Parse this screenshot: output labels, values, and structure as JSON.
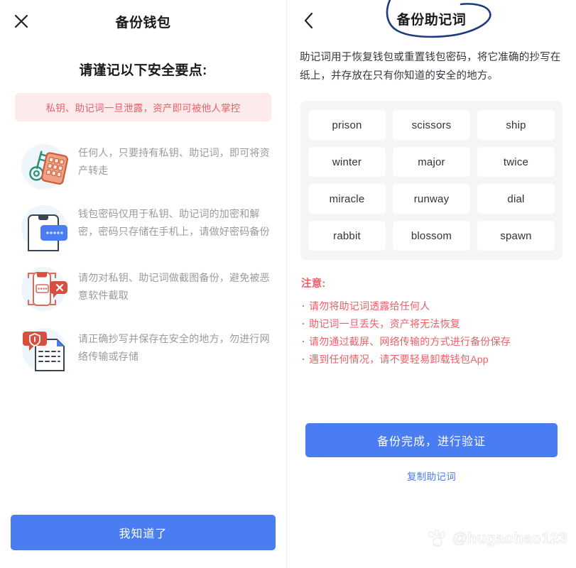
{
  "left_panel": {
    "close_icon": "close-icon",
    "title": "备份钱包",
    "section_heading": "请谨记以下安全要点:",
    "alert_banner": "私钥、助记词一旦泄露，资产即可被他人掌控",
    "tips": [
      {
        "icon": "key-and-keypad-icon",
        "text": "任何人，只要持有私钥、助记词，即可将资产转走"
      },
      {
        "icon": "phone-password-icon",
        "text": "钱包密码仅用于私钥、助记词的加密和解密，密码只存储在手机上，请做好密码备份"
      },
      {
        "icon": "no-screenshot-icon",
        "text": "请勿对私钥、助记词做截图备份，避免被恶意软件截取"
      },
      {
        "icon": "secure-document-icon",
        "text": "请正确抄写并保存在安全的地方，勿进行网络传输或存储"
      }
    ],
    "primary_button": "我知道了"
  },
  "right_panel": {
    "back_icon": "chevron-left-icon",
    "title": "备份助记词",
    "annotation": "hand-drawn-circle",
    "description": "助记词用于恢复钱包或重置钱包密码，将它准确的抄写在纸上，并存放在只有你知道的安全的地方。",
    "mnemonic_words": [
      "prison",
      "scissors",
      "ship",
      "winter",
      "major",
      "twice",
      "miracle",
      "runway",
      "dial",
      "rabbit",
      "blossom",
      "spawn"
    ],
    "notice_title": "注意:",
    "notice_items": [
      "请勿将助记词透露给任何人",
      "助记词一旦丢失，资产将无法恢复",
      "请勿通过截屏、网络传输的方式进行备份保存",
      "遇到任何情况，请不要轻易卸载钱包App"
    ],
    "verify_button": "备份完成，进行验证",
    "copy_link": "复制助记词"
  },
  "watermark": {
    "logo": "baidu-paw-icon",
    "handle": "@hugaohao123"
  },
  "colors": {
    "primary_blue": "#4a7cf2",
    "warning_red": "#e8606a",
    "alert_bg": "#fdeaea",
    "chip_bg": "#f4f5f7",
    "annotation_navy": "#1f3a80"
  }
}
